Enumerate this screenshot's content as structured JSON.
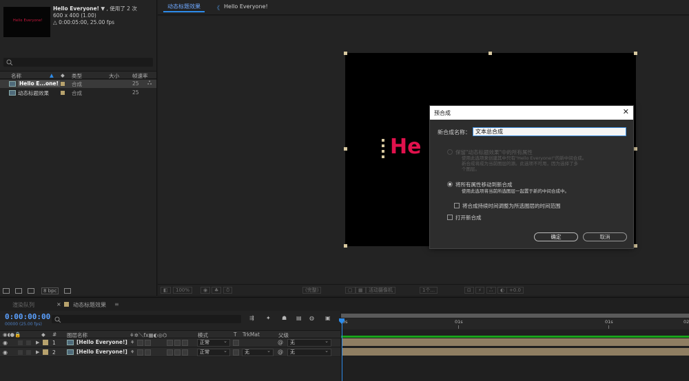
{
  "project": {
    "comp_name": "Hello Everyone!",
    "usage": "使用了 2 次",
    "size": "600 x 400 (1.00)",
    "duration": "△ 0:00:05:00, 25.00 fps",
    "thumb_text": "Hello Everyone!",
    "columns": {
      "name": "名称",
      "type": "类型",
      "size": "大小",
      "fps": "帧速率"
    },
    "items": [
      {
        "name": "Hello E...one!",
        "type": "合成",
        "fps": "25"
      },
      {
        "name": "动态标题效果",
        "type": "合成",
        "fps": "25"
      }
    ],
    "bpc": "8 bpc"
  },
  "viewer": {
    "tab": "动态标题效果",
    "breadcrumb_sep": "《",
    "sub_tab": "Hello Everyone!",
    "canvas_text": "He l",
    "bar": {
      "zoom": "100%",
      "resolution": "(完整)",
      "camera": "活动摄像机",
      "views": "1个...",
      "exposure": "+0.0"
    }
  },
  "dialog": {
    "title": "预合成",
    "close": "✕",
    "name_label": "新合成名称：",
    "name_value": "文本总合成",
    "option1_title": "保留\"动态标题效果\"中的所有属性",
    "option1_desc1": "使用此选项来创建其中只有\"Hello Everyone!\"的新中间合成。",
    "option1_desc2": "新合成将成为当前图层的源。此选项不可用，因为选择了多",
    "option1_desc3": "个图层。",
    "option2_title": "将所有属性移动到新合成",
    "option2_desc": "使用此选项将当前所选图层一起置于新的中间合成中。",
    "check1": "将合成持续时间调整为所选图层的时间范围",
    "check2": "打开新合成",
    "ok": "确定",
    "cancel": "取消"
  },
  "timeline": {
    "tab_render": "渲染队列",
    "tab_close": "×",
    "tab_comp": "动态标题效果",
    "tab_menu": "≡",
    "timecode": "0:00:00:00",
    "timecode_sub": "00000 (25.00 fps)",
    "columns": {
      "layer_name": "图层名称",
      "mode": "模式",
      "t": "T",
      "trkmat": "TrkMat",
      "parent": "父级"
    },
    "layers": [
      {
        "num": "1",
        "name": "[Hello Everyone!]",
        "mode": "正常",
        "trkmat": "",
        "parent": "无"
      },
      {
        "num": "2",
        "name": "[Hello Everyone!]",
        "mode": "正常",
        "trkmat": "无",
        "parent": "无"
      }
    ],
    "ruler": [
      "0s",
      "01s",
      "01s",
      "02"
    ]
  },
  "colors": {
    "accent": "#2d8ceb",
    "label_tan": "#b7a26d",
    "canvas_text": "#e0114c"
  }
}
